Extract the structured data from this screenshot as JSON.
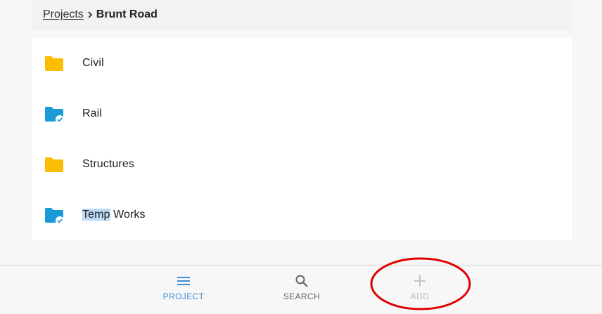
{
  "breadcrumb": {
    "parent": "Projects",
    "current": "Brunt Road"
  },
  "folders": [
    {
      "name": "Civil",
      "icon": "folder-icon",
      "color": "#fbbc05"
    },
    {
      "name": "Rail",
      "icon": "synced-folder-icon",
      "color": "#1a9ad6"
    },
    {
      "name": "Structures",
      "icon": "folder-icon",
      "color": "#fbbc05"
    },
    {
      "name": "Temp Works",
      "highlighted": "Temp",
      "rest": " Works",
      "icon": "synced-folder-icon",
      "color": "#1a9ad6"
    }
  ],
  "bottom_nav": {
    "project": {
      "label": "PROJECT",
      "icon": "menu-icon",
      "color": "#3d8fd9",
      "active": true
    },
    "search": {
      "label": "SEARCH",
      "icon": "search-icon",
      "color": "#666666"
    },
    "add": {
      "label": "ADD",
      "icon": "plus-icon",
      "color": "#bdbdbd",
      "disabled": true
    }
  },
  "annotation": {
    "shape": "ellipse",
    "color": "#e00000",
    "target": "add"
  }
}
